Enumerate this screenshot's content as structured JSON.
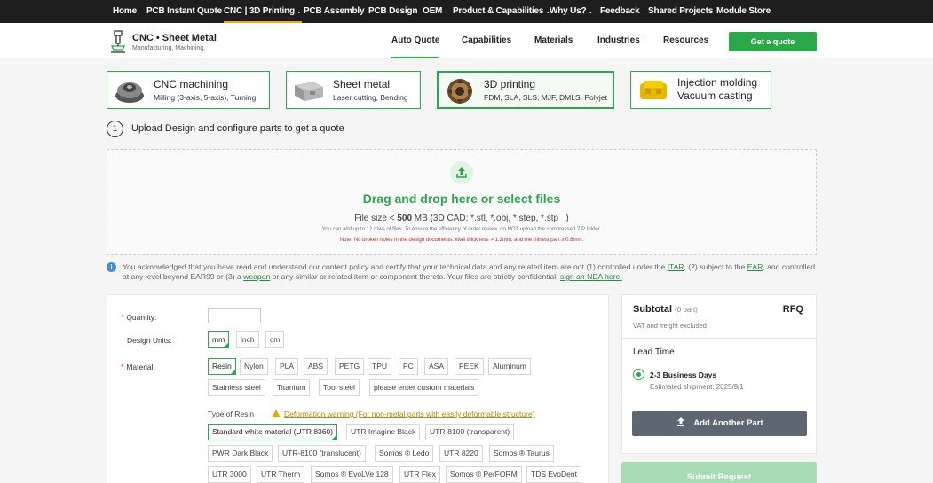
{
  "topnav": {
    "items": [
      {
        "label": "Home",
        "caret": ""
      },
      {
        "label": "PCB Instant Quote",
        "caret": ""
      },
      {
        "label": "CNC | 3D Printing",
        "caret": "⌄"
      },
      {
        "label": "PCB Assembly",
        "caret": ""
      },
      {
        "label": "PCB Design",
        "caret": ""
      },
      {
        "label": "OEM",
        "caret": ""
      },
      {
        "label": "Product & Capabilities",
        "caret": "⌄"
      },
      {
        "label": "Why Us?",
        "caret": "⌄"
      },
      {
        "label": "Feedback",
        "caret": ""
      },
      {
        "label": "Shared Projects",
        "caret": ""
      },
      {
        "label": "Module Store",
        "caret": ""
      }
    ],
    "active_index": 2
  },
  "subnav": {
    "logo_title": "CNC • Sheet Metal",
    "logo_sub": "Manufacturing, Machining.",
    "logo_icon": "milling-tool-icon",
    "items": [
      "Auto Quote",
      "Capabilities",
      "Materials",
      "Industries",
      "Resources"
    ],
    "active_index": 0,
    "quote_button": "Get a quote"
  },
  "processes": [
    {
      "title": "CNC machining",
      "sub": "Milling (3-axis, 5-axis), Turning",
      "icon": "cnc-part-icon"
    },
    {
      "title": "Sheet metal",
      "sub": "Laser cutting, Bending",
      "icon": "sheet-metal-part-icon"
    },
    {
      "title": "3D printing",
      "sub": "FDM, SLA, SLS, MJF, DMLS, Polyjet",
      "icon": "3d-printed-part-icon"
    },
    {
      "title": "Injection molding",
      "sub": "Vacuum casting",
      "icon": "molded-part-icon"
    }
  ],
  "selected_process_index": 2,
  "step": {
    "number": "1",
    "text": "Upload Design and configure parts to get a quote"
  },
  "upload": {
    "title": "Drag and drop here or select files",
    "size_prefix": "File size < ",
    "size_value": "500",
    "size_suffix": " MB (3D CAD: *.stl, *.obj, *.step, *.stp   )",
    "note": "You can add up to 12 rows of files. To ensure the efficiency of order review, do NOT upload the compressed ZIP folder.",
    "warning": "Note: No broken holes in the design documents. Wall thickness > 1.2mm, and the thinest part ≥ 0.8mm."
  },
  "policy": {
    "t1": "You acknowledged that you have read and understand our content policy and certify that your technical data and any related item are not (1) controlled under the ",
    "link_itar": "ITAR",
    "t2": ", (2) subject to the ",
    "link_ear": "EAR",
    "t3": ", and controlled at any level beyond EAR99 or (3) a ",
    "link_weapon": "weapon",
    "t4": " or any similar or related item or component thereto. Your files are strictly confidential, ",
    "link_nda": "sign an NDA here."
  },
  "config": {
    "quantity_label": "Quantity:",
    "quantity_value": "",
    "units_label": "Design Units:",
    "units": [
      "mm",
      "inch",
      "cm"
    ],
    "selected_unit_index": 0,
    "material_label": "Material:",
    "materials": [
      "Resin",
      "Nylon",
      "PLA",
      "ABS",
      "PETG",
      "TPU",
      "PC",
      "ASA",
      "PEEK",
      "Aluminum",
      "Stainless steel",
      "Titanium",
      "Tool steel",
      "please enter custom materials"
    ],
    "selected_material_index": 0,
    "resin_label": "Type of Resin",
    "warning_link": "Deformation warning (For non-metal parts with easily deformable structure)",
    "resins": [
      "Standard white material (UTR 8360)",
      "UTR Imagine Black",
      "UTR-8100 (transparent)",
      "PWR Dark Black",
      "UTR-8100 (translucent)",
      "Somos ® Ledo",
      "UTR 8220",
      "Somos ® Taurus",
      "UTR 3000",
      "UTR Therm",
      "Somos ® EvoLVe 128",
      "UTR Flex",
      "Somos ® PerFORM",
      "TDS EvoDent"
    ],
    "selected_resin_index": 0
  },
  "subtotal": {
    "title": "Subtotal",
    "count": "(0 part)",
    "rfq": "RFQ",
    "vat": "VAT and freight excluded",
    "lead_title": "Lead Time",
    "lead_option": "2-3 Business Days",
    "lead_ship": "Estimated shipment: 2025/9/1",
    "add_part": "Add Another Part",
    "submit": "Submit Request"
  },
  "colors": {
    "brand_green": "#2aa84a",
    "nav_bg": "#1e1e1e",
    "nav_active": "#f5a623"
  }
}
